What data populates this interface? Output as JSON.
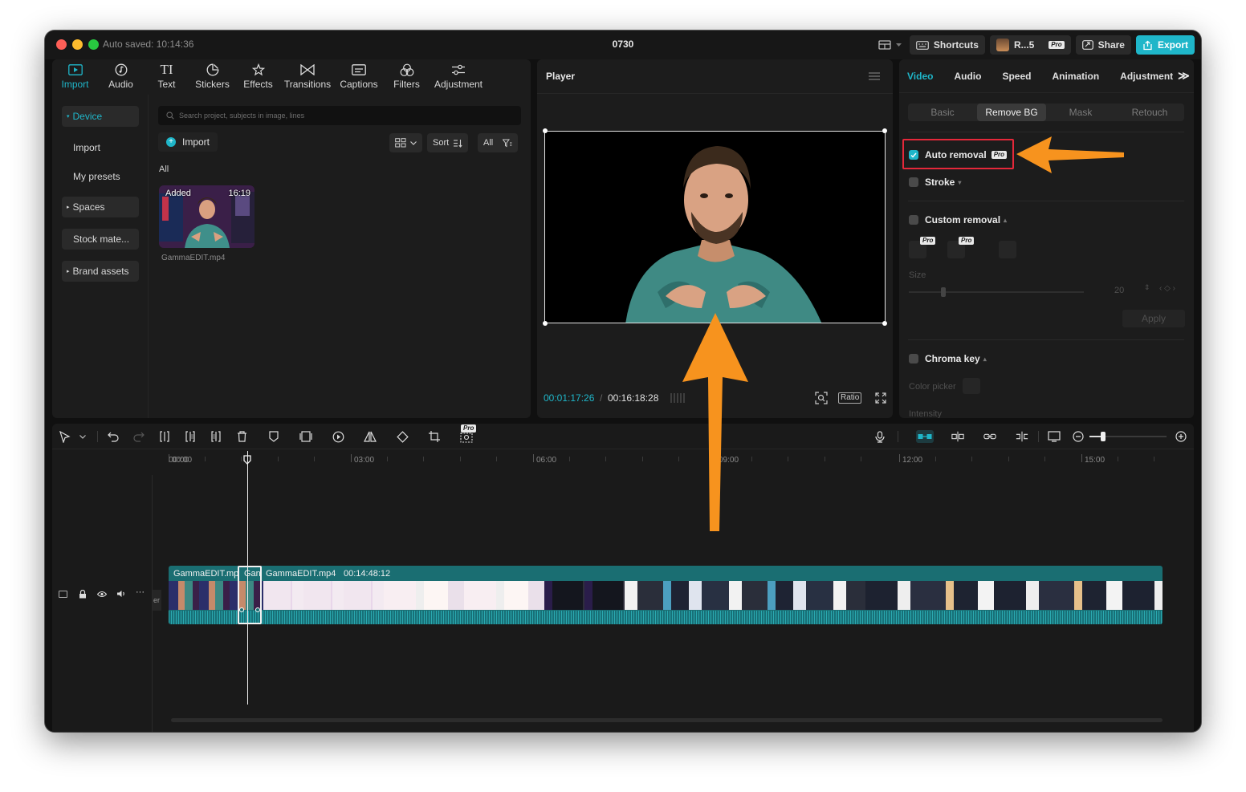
{
  "window": {
    "autosave": "Auto saved: 10:14:36",
    "title": "0730",
    "titlebar_buttons": {
      "shortcuts": "Shortcuts",
      "account": "R...5",
      "pro_badge": "Pro",
      "share": "Share",
      "export": "Export"
    }
  },
  "media": {
    "tabs": [
      {
        "label": "Import",
        "icon": "import-icon"
      },
      {
        "label": "Audio",
        "icon": "audio-icon"
      },
      {
        "label": "Text",
        "icon": "text-icon"
      },
      {
        "label": "Stickers",
        "icon": "stickers-icon"
      },
      {
        "label": "Effects",
        "icon": "effects-icon"
      },
      {
        "label": "Transitions",
        "icon": "transitions-icon"
      },
      {
        "label": "Captions",
        "icon": "captions-icon"
      },
      {
        "label": "Filters",
        "icon": "filters-icon"
      },
      {
        "label": "Adjustment",
        "icon": "adjustment-icon"
      }
    ],
    "sidebar": [
      {
        "label": "Device"
      },
      {
        "label": "Import"
      },
      {
        "label": "My presets"
      },
      {
        "label": "Spaces"
      },
      {
        "label": "Stock mate..."
      },
      {
        "label": "Brand assets"
      }
    ],
    "search_placeholder": "Search project, subjects in image, lines",
    "import_button": "Import",
    "sort_label": "Sort",
    "filter_all": "All",
    "section_label": "All",
    "item": {
      "badge": "Added",
      "duration": "16:19",
      "name": "GammaEDIT.mp4"
    }
  },
  "player": {
    "title": "Player",
    "current_time": "00:01:17:26",
    "total_time": "00:16:18:28",
    "ratio_label": "Ratio"
  },
  "inspector": {
    "tabs": [
      "Video",
      "Audio",
      "Speed",
      "Animation",
      "Adjustment"
    ],
    "subtabs": [
      "Basic",
      "Remove BG",
      "Mask",
      "Retouch"
    ],
    "auto_removal": "Auto removal",
    "auto_removal_checked": true,
    "pro_badge": "Pro",
    "stroke": "Stroke",
    "custom_removal": "Custom removal",
    "size_label": "Size",
    "size_value": "20",
    "apply": "Apply",
    "chroma_key": "Chroma key",
    "color_picker": "Color picker",
    "intensity": "Intensity"
  },
  "timeline": {
    "ruler": [
      "00:00",
      "03:00",
      "06:00",
      "09:00",
      "12:00",
      "15:00"
    ],
    "clips": [
      {
        "label": "GammaEDIT.mp"
      },
      {
        "label": "Gan"
      },
      {
        "label": "GammaEDIT.mp4",
        "duration": "00:14:48:12"
      }
    ],
    "track_side_label": "er"
  },
  "colors": {
    "accent": "#1fb6c9",
    "annotation_arrow": "#f7931e",
    "highlight_box": "#e5283a"
  }
}
